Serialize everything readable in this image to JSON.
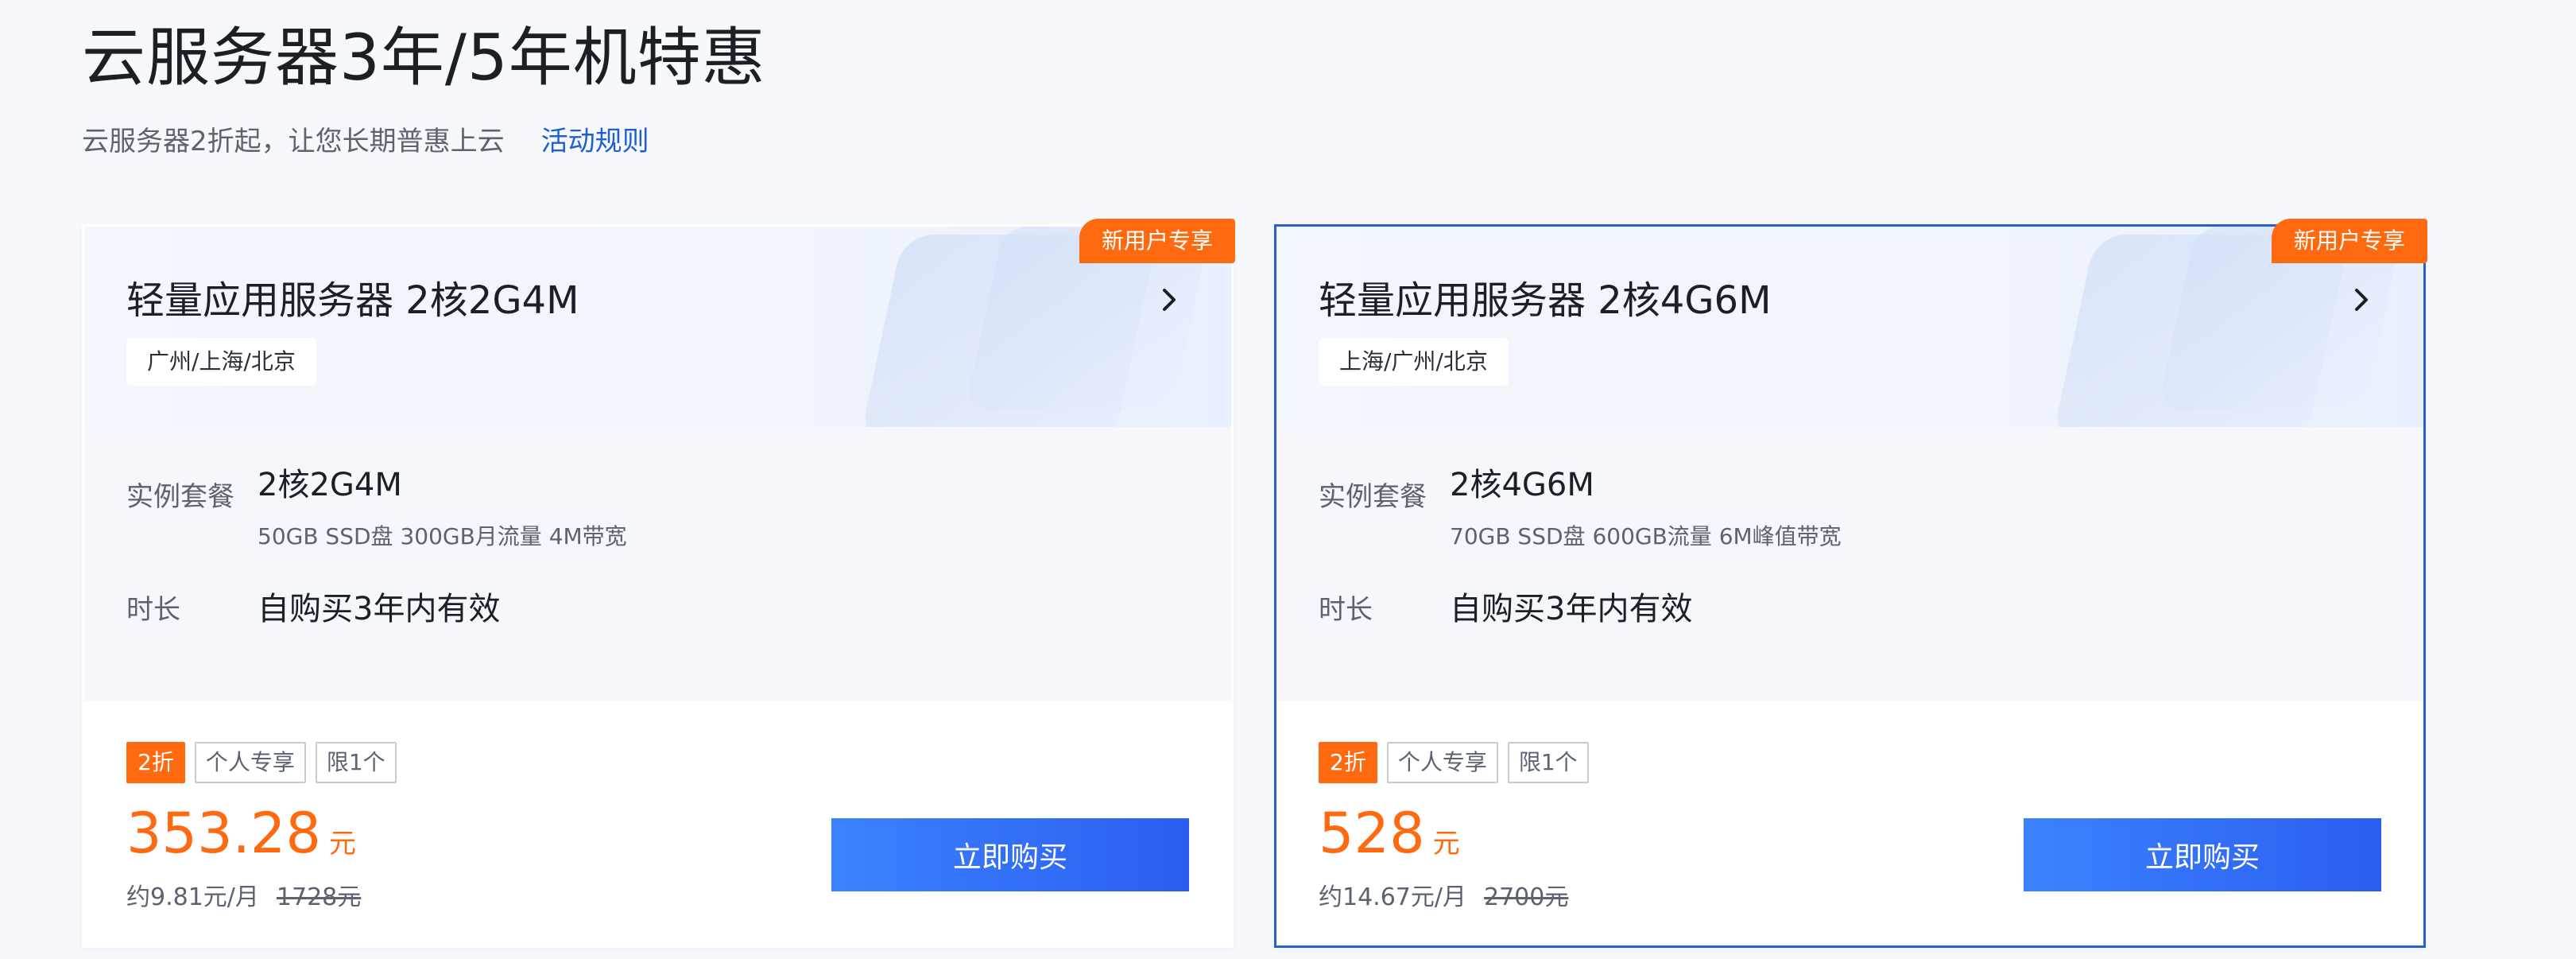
{
  "page": {
    "title": "云服务器3年/5年机特惠",
    "subtitle": "云服务器2折起，让您长期普惠上云",
    "rules_link": "活动规则"
  },
  "cards": [
    {
      "badge": "新用户专享",
      "product_name": "轻量应用服务器 2核2G4M",
      "region": "广州/上海/北京",
      "spec_label": "实例套餐",
      "spec_title": "2核2G4M",
      "spec_detail": "50GB SSD盘 300GB月流量 4M带宽",
      "duration_label": "时长",
      "duration_value": "自购买3年内有效",
      "tags": [
        "2折",
        "个人专享",
        "限1个"
      ],
      "price": "353.28",
      "currency": "元",
      "monthly": "约9.81元/月",
      "original_price": "1728元",
      "buy_label": "立即购买",
      "selected": false
    },
    {
      "badge": "新用户专享",
      "product_name": "轻量应用服务器 2核4G6M",
      "region": "上海/广州/北京",
      "spec_label": "实例套餐",
      "spec_title": "2核4G6M",
      "spec_detail": "70GB SSD盘 600GB流量 6M峰值带宽",
      "duration_label": "时长",
      "duration_value": "自购买3年内有效",
      "tags": [
        "2折",
        "个人专享",
        "限1个"
      ],
      "price": "528",
      "currency": "元",
      "monthly": "约14.67元/月",
      "original_price": "2700元",
      "buy_label": "立即购买",
      "selected": true
    }
  ],
  "colors": {
    "accent_orange": "#ff6a10",
    "link_blue": "#1f5fd6",
    "button_blue_start": "#3c82ff",
    "button_blue_end": "#2a5ef0",
    "selected_border": "#2a61c9"
  },
  "icons": {
    "chevron": "chevron-right-icon"
  }
}
